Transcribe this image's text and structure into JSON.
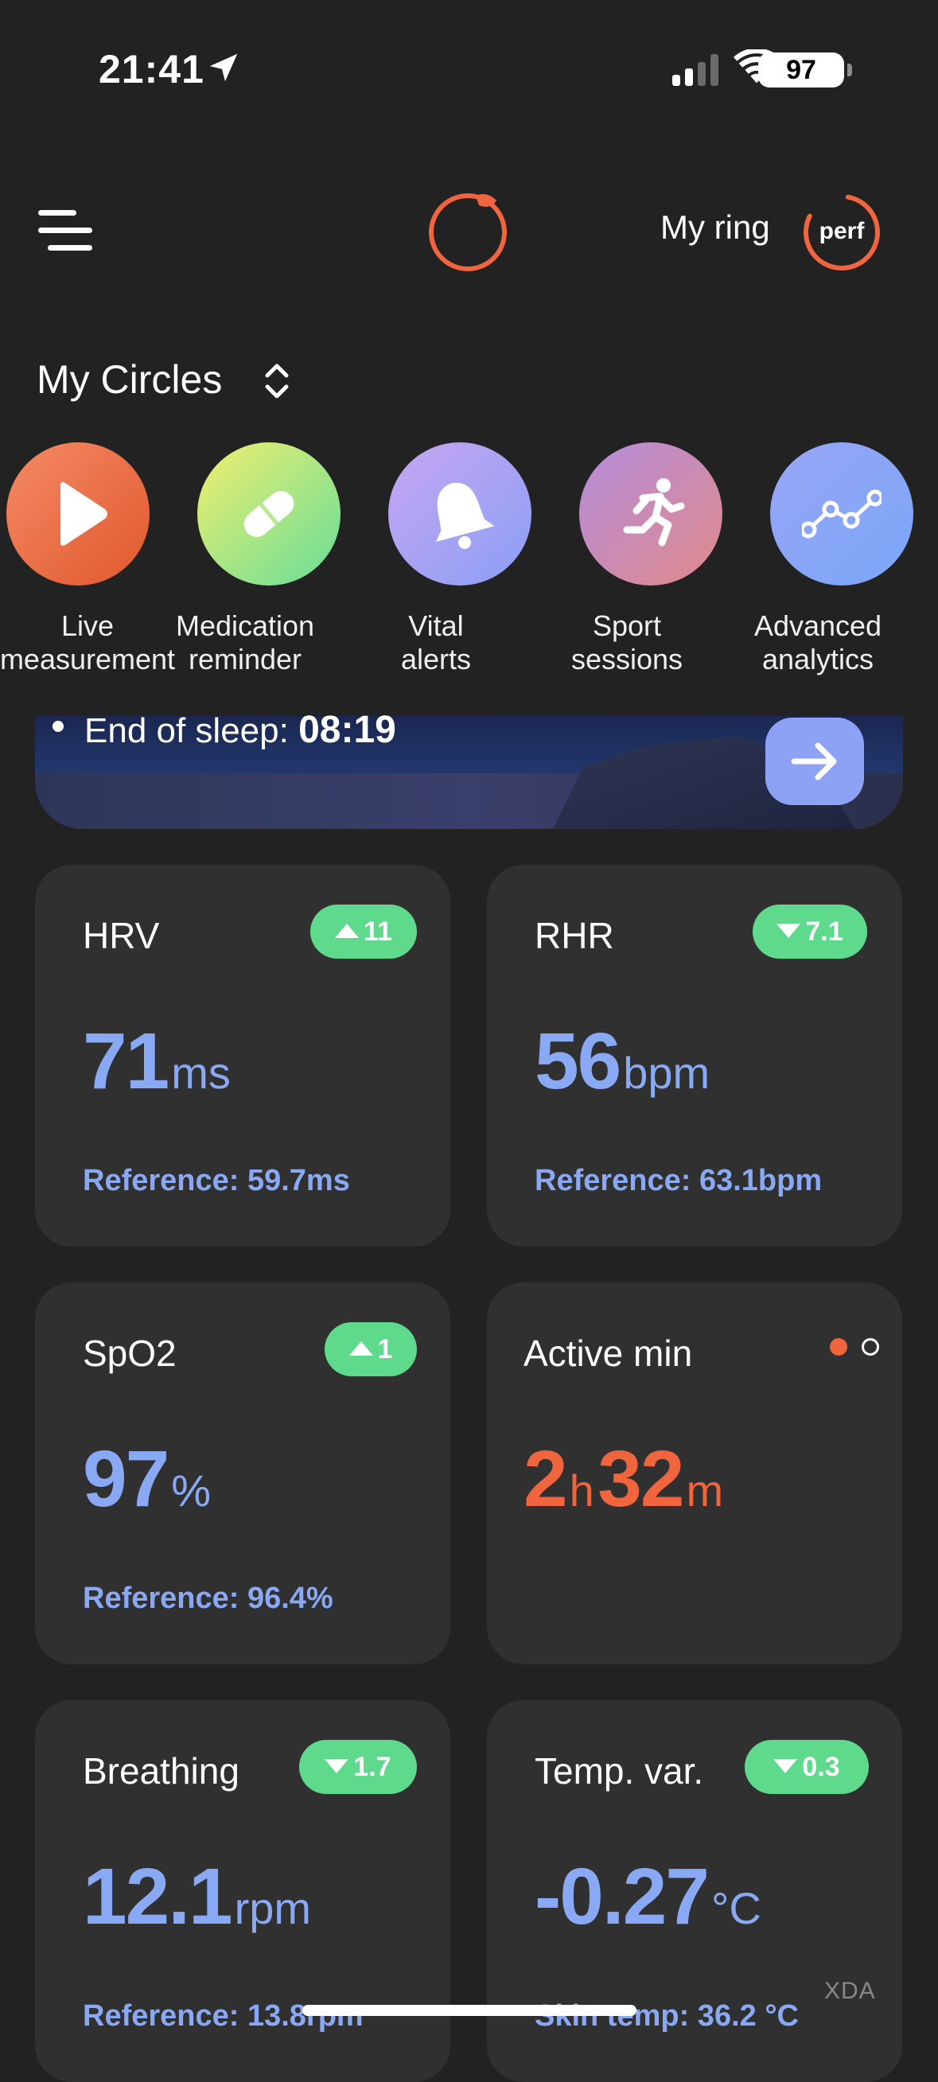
{
  "status_bar": {
    "time": "21:41",
    "battery": "97",
    "icons": [
      "location-arrow-icon",
      "cellular-signal-icon",
      "wifi-icon",
      "battery-icon"
    ]
  },
  "header": {
    "ring_label": "My ring",
    "perf_label": "perf",
    "accent_color": "#f0643e"
  },
  "circles": {
    "title": "My Circles",
    "items": [
      {
        "line1": "Live",
        "line2": "measurement",
        "icon": "play-icon",
        "colors": [
          "#f58a66",
          "#e0582c"
        ]
      },
      {
        "line1": "Medication",
        "line2": "reminder",
        "icon": "pill-icon",
        "colors": [
          "#f2ef6e",
          "#66dd9a"
        ]
      },
      {
        "line1": "Vital",
        "line2": "alerts",
        "icon": "bell-icon",
        "colors": [
          "#c7a6f2",
          "#8a9ff5"
        ]
      },
      {
        "line1": "Sport",
        "line2": "sessions",
        "icon": "running-icon",
        "colors": [
          "#b58cdc",
          "#e08a8a"
        ]
      },
      {
        "line1": "Advanced",
        "line2": "analytics",
        "icon": "analytics-icon",
        "colors": [
          "#9aa5f7",
          "#7aa6f7"
        ]
      }
    ]
  },
  "sleep": {
    "label": "End of sleep:",
    "time": "08:19"
  },
  "metrics": [
    {
      "title": "HRV",
      "trend": "up",
      "delta": "11",
      "value": "71",
      "unit": "ms",
      "reference": "Reference: 59.7ms"
    },
    {
      "title": "RHR",
      "trend": "down",
      "delta": "7.1",
      "value": "56",
      "unit": "bpm",
      "reference": "Reference: 63.1bpm"
    },
    {
      "title": "SpO2",
      "trend": "up",
      "delta": "1",
      "value": "97",
      "unit": "%",
      "reference": "Reference: 96.4%"
    },
    {
      "title": "Active min",
      "hours": "2",
      "hours_unit": "h",
      "minutes": "32",
      "minutes_unit": "m"
    },
    {
      "title": "Breathing",
      "trend": "down",
      "delta": "1.7",
      "value": "12.1",
      "unit": "rpm",
      "reference": "Reference: 13.8rpm"
    },
    {
      "title": "Temp. var.",
      "trend": "down",
      "delta": "0.3",
      "value": "-0.27",
      "unit": "°C",
      "reference": "Skin temp: 36.2 °C"
    }
  ],
  "watermark": "XDA"
}
